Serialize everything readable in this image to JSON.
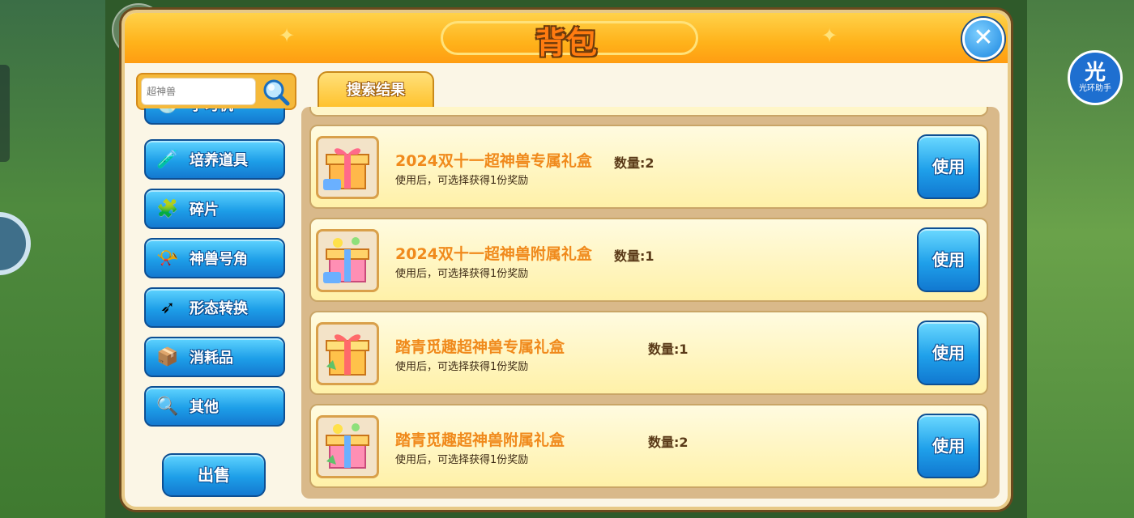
{
  "header": {
    "title": "背包",
    "close_icon": "close-icon"
  },
  "helper_badge": {
    "glyph": "光",
    "label": "光环助手"
  },
  "search": {
    "placeholder": "超神兽",
    "icon": "magnifier-icon"
  },
  "sidebar": {
    "items": [
      {
        "label": "学习机",
        "icon": "disc-icon"
      },
      {
        "label": "培养道具",
        "icon": "potion-icon"
      },
      {
        "label": "碎片",
        "icon": "puzzle-icon"
      },
      {
        "label": "神兽号角",
        "icon": "horn-icon"
      },
      {
        "label": "形态转换",
        "icon": "arrow-icon"
      },
      {
        "label": "消耗品",
        "icon": "box-icon"
      },
      {
        "label": "其他",
        "icon": "magnifier-icon"
      }
    ],
    "sell_label": "出售"
  },
  "tab": {
    "label": "搜索结果"
  },
  "items": [
    {
      "name": "2024双十一超神兽专属礼盒",
      "qty": "数量:2",
      "desc": "使用后，可选择获得1份奖励",
      "use_label": "使用",
      "icon": "gift-box-icon"
    },
    {
      "name": "2024双十一超神兽附属礼盒",
      "qty": "数量:1",
      "desc": "使用后，可选择获得1份奖励",
      "use_label": "使用",
      "icon": "gift-box-icon"
    },
    {
      "name": "踏青觅趣超神兽专属礼盒",
      "qty": "数量:1",
      "desc": "使用后，可选择获得1份奖励",
      "use_label": "使用",
      "icon": "gift-box-icon"
    },
    {
      "name": "踏青觅趣超神兽附属礼盒",
      "qty": "数量:2",
      "desc": "使用后，可选择获得1份奖励",
      "use_label": "使用",
      "icon": "gift-box-icon"
    }
  ],
  "colors": {
    "accent_orange": "#ff9d12",
    "button_blue": "#1d9ee8",
    "item_name": "#f08a1c"
  }
}
